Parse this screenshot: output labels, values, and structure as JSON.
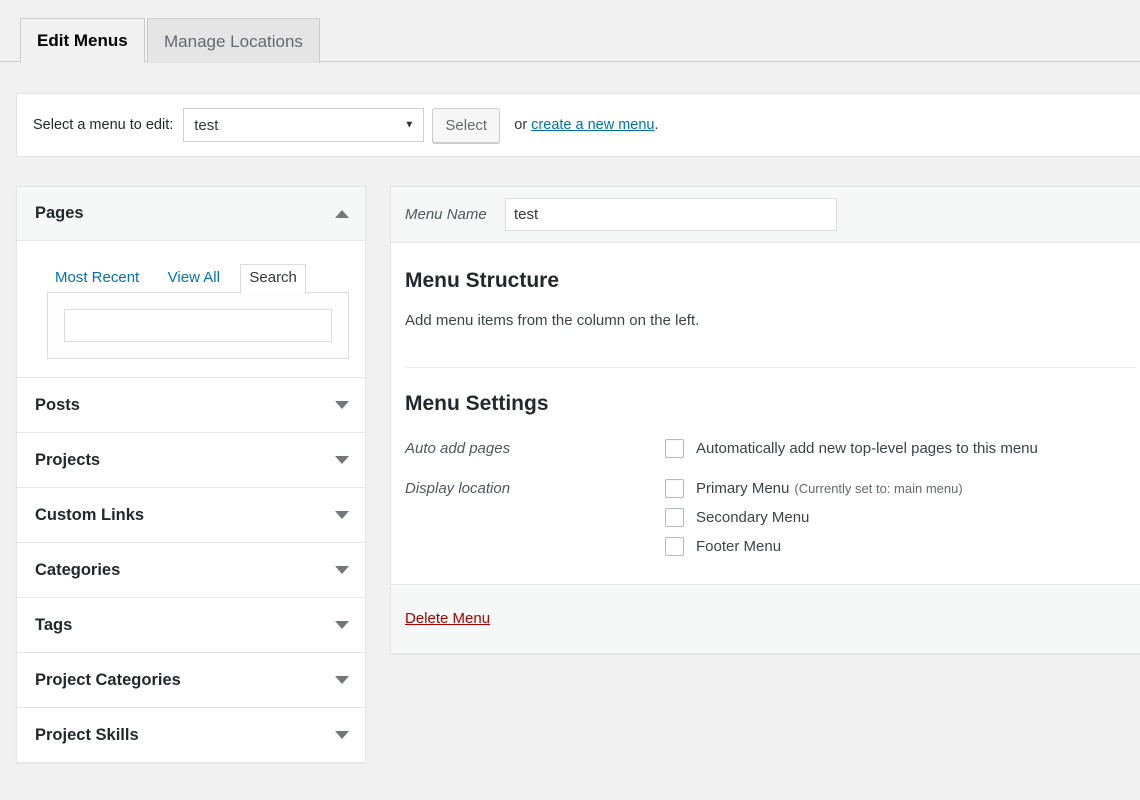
{
  "tabs": [
    {
      "label": "Edit Menus",
      "active": true
    },
    {
      "label": "Manage Locations",
      "active": false
    }
  ],
  "menu_selector": {
    "label": "Select a menu to edit:",
    "selected_value": "test",
    "options": [
      "test"
    ],
    "select_button_label": "Select",
    "or_text": "or ",
    "create_link_label": "create a new menu",
    "trailing_period": ".",
    "caret_icon": "chevron-down-icon"
  },
  "sidebar": {
    "panels": [
      {
        "title": "Pages",
        "expanded": true,
        "toggle_icon": "chevron-up-icon",
        "tabs": [
          {
            "label": "Most Recent",
            "active": false
          },
          {
            "label": "View All",
            "active": false
          },
          {
            "label": "Search",
            "active": true
          }
        ],
        "search_value": "",
        "search_placeholder": ""
      },
      {
        "title": "Posts",
        "expanded": false,
        "toggle_icon": "chevron-down-icon"
      },
      {
        "title": "Projects",
        "expanded": false,
        "toggle_icon": "chevron-down-icon"
      },
      {
        "title": "Custom Links",
        "expanded": false,
        "toggle_icon": "chevron-down-icon"
      },
      {
        "title": "Categories",
        "expanded": false,
        "toggle_icon": "chevron-down-icon"
      },
      {
        "title": "Tags",
        "expanded": false,
        "toggle_icon": "chevron-down-icon"
      },
      {
        "title": "Project Categories",
        "expanded": false,
        "toggle_icon": "chevron-down-icon"
      },
      {
        "title": "Project Skills",
        "expanded": false,
        "toggle_icon": "chevron-down-icon"
      }
    ]
  },
  "editor": {
    "menu_name_label": "Menu Name",
    "menu_name_value": "test",
    "menu_name_placeholder": "Menu Name",
    "structure_heading": "Menu Structure",
    "structure_description": "Add menu items from the column on the left.",
    "settings_heading": "Menu Settings",
    "auto_add_label": "Auto add pages",
    "auto_add_checkbox": {
      "label": "Automatically add new top-level pages to this menu",
      "checked": false
    },
    "display_location_label": "Display location",
    "locations": [
      {
        "label": "Primary Menu",
        "note": "(Currently set to: main menu)",
        "checked": false
      },
      {
        "label": "Secondary Menu",
        "note": "",
        "checked": false
      },
      {
        "label": "Footer Menu",
        "note": "",
        "checked": false
      }
    ],
    "delete_link_label": "Delete Menu"
  },
  "colors": {
    "page_background": "#f1f1f1",
    "panel_background": "#ffffff",
    "shaded_background": "#f6f7f7",
    "border": "#e5e5e5",
    "link": "#0073aa",
    "delete_link": "#a00000",
    "text": "#32373c",
    "muted_text": "#646970"
  }
}
